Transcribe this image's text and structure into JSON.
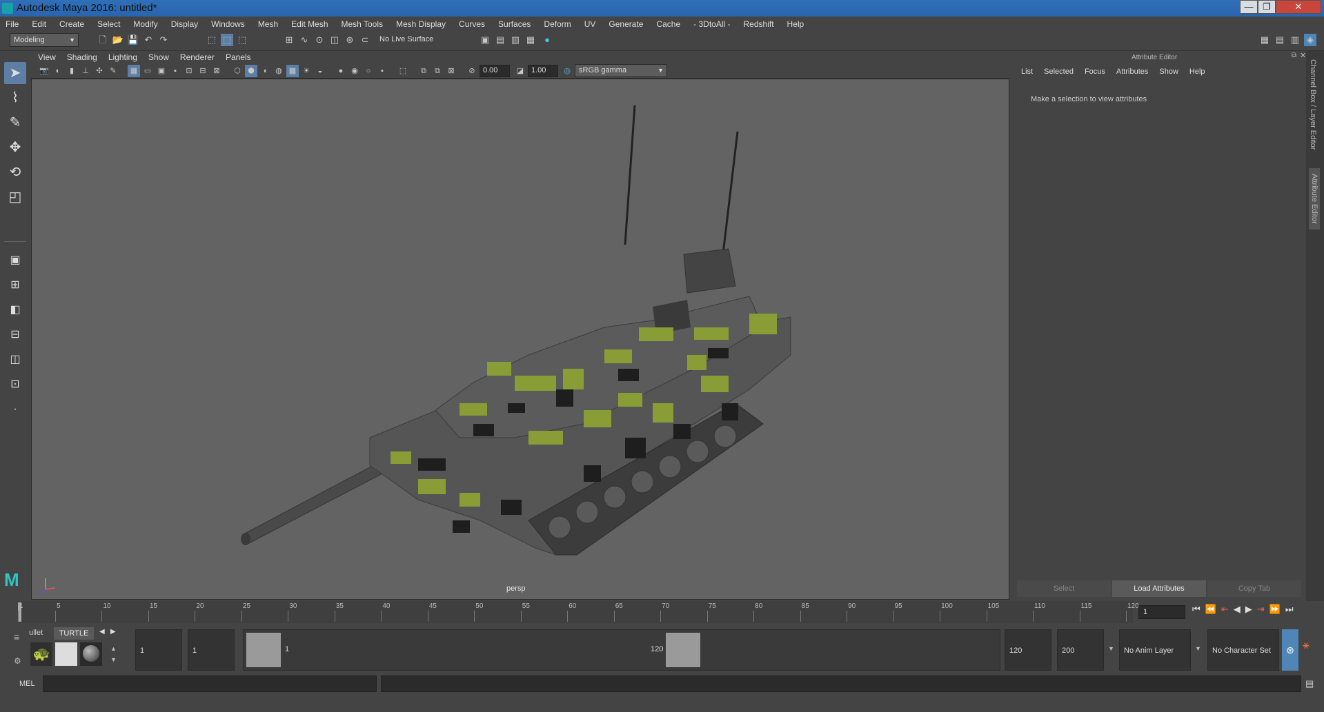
{
  "window": {
    "title": "Autodesk Maya 2016: untitled*",
    "min_label": "—",
    "max_label": "❐",
    "close_label": "✕"
  },
  "menubar": {
    "items": [
      "File",
      "Edit",
      "Create",
      "Select",
      "Modify",
      "Display",
      "Windows",
      "Mesh",
      "Edit Mesh",
      "Mesh Tools",
      "Mesh Display",
      "Curves",
      "Surfaces",
      "Deform",
      "UV",
      "Generate",
      "Cache",
      "- 3DtoAll -",
      "Redshift",
      "Help"
    ]
  },
  "statusline": {
    "mode": "Modeling",
    "live_surface": "No Live Surface"
  },
  "panel": {
    "menu": [
      "View",
      "Shading",
      "Lighting",
      "Show",
      "Renderer",
      "Panels"
    ],
    "exposure": "0.00",
    "gamma": "1.00",
    "colorspace": "sRGB gamma",
    "camera_label": "persp"
  },
  "attribute_editor": {
    "title": "Attribute Editor",
    "menu": [
      "List",
      "Selected",
      "Focus",
      "Attributes",
      "Show",
      "Help"
    ],
    "message": "Make a selection to view attributes",
    "buttons": {
      "select": "Select",
      "load": "Load Attributes",
      "copy_tab": "Copy Tab"
    }
  },
  "side_tabs": {
    "channel_box": "Channel Box / Layer Editor",
    "attribute_editor": "Attribute Editor"
  },
  "timeslider": {
    "ticks": [
      "1",
      "5",
      "10",
      "15",
      "20",
      "25",
      "30",
      "35",
      "40",
      "45",
      "50",
      "55",
      "60",
      "65",
      "70",
      "75",
      "80",
      "85",
      "90",
      "95",
      "100",
      "105",
      "110",
      "115",
      "120"
    ],
    "current_frame": "1"
  },
  "range": {
    "shelf_tab_partial": "ullet",
    "shelf_tab": "TURTLE",
    "start_time": "1",
    "playback_start": "1",
    "range_start_label": "1",
    "range_end_label": "120",
    "playback_end": "120",
    "end_time": "200",
    "anim_layer": "No Anim Layer",
    "character_set": "No Character Set"
  },
  "cmdline": {
    "label": "MEL"
  }
}
